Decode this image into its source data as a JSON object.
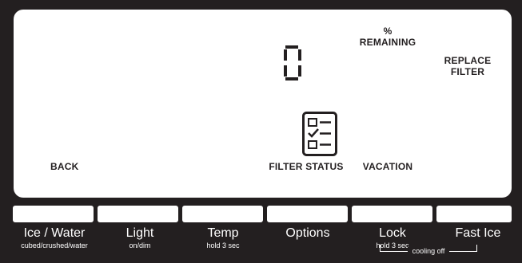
{
  "display": {
    "percent_sign": "%",
    "remaining_label": "REMAINING",
    "replace_filter_line1": "REPLACE",
    "replace_filter_line2": "FILTER",
    "back_label": "BACK",
    "filter_status_label": "FILTER STATUS",
    "vacation_label": "VACATION",
    "filter_digit": "0"
  },
  "buttons": [
    {
      "label": "Ice / Water",
      "sub": "cubed/crushed/water"
    },
    {
      "label": "Light",
      "sub": "on/dim"
    },
    {
      "label": "Temp",
      "sub": "hold 3 sec"
    },
    {
      "label": "Options",
      "sub": ""
    },
    {
      "label": "Lock",
      "sub": "hold 3 sec"
    },
    {
      "label": "Fast Ice",
      "sub": ""
    }
  ],
  "cooling_off_label": "cooling off",
  "colors": {
    "panel_bg": "#231f20",
    "screen": "#ffffff"
  }
}
